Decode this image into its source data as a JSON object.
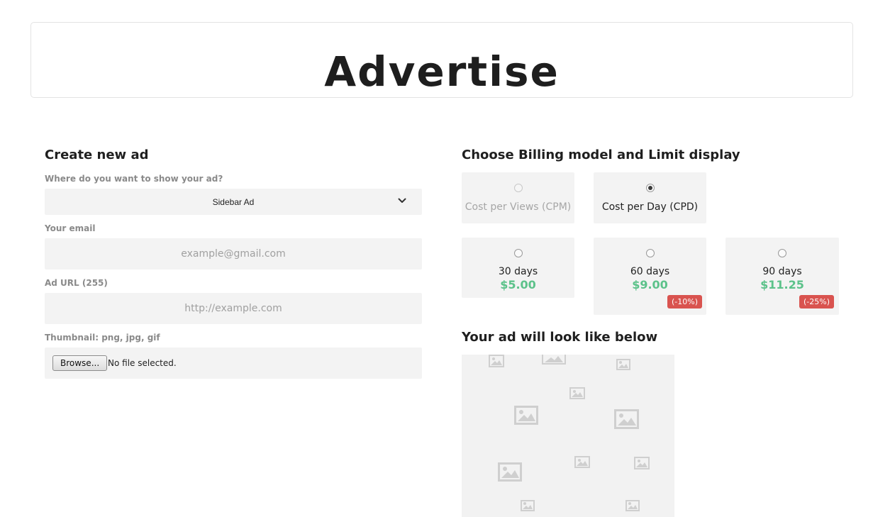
{
  "header": {
    "title": "Advertise"
  },
  "form": {
    "heading": "Create new ad",
    "placement": {
      "label": "Where do you want to show your ad?",
      "selected": "Sidebar Ad"
    },
    "email": {
      "label": "Your email",
      "placeholder": "example@gmail.com",
      "value": ""
    },
    "url": {
      "label": "Ad URL (255)",
      "placeholder": "http://example.com",
      "value": ""
    },
    "thumbnail": {
      "label": "Thumbnail: png, jpg, gif",
      "browse_label": "Browse...",
      "status": "No file selected."
    }
  },
  "billing": {
    "heading": "Choose Billing model and Limit display",
    "models": [
      {
        "label": "Cost per Views (CPM)",
        "selected": false,
        "disabled": true
      },
      {
        "label": "Cost per Day (CPD)",
        "selected": true,
        "disabled": false
      }
    ],
    "durations": [
      {
        "label": "30 days",
        "price": "$5.00",
        "discount": ""
      },
      {
        "label": "60 days",
        "price": "$9.00",
        "discount": "(-10%)"
      },
      {
        "label": "90 days",
        "price": "$11.25",
        "discount": "(-25%)"
      }
    ]
  },
  "preview": {
    "heading": "Your ad will look like below"
  },
  "colors": {
    "price_green": "#5cc28a",
    "discount_red": "#d9534f",
    "field_bg": "#f3f3f3"
  }
}
